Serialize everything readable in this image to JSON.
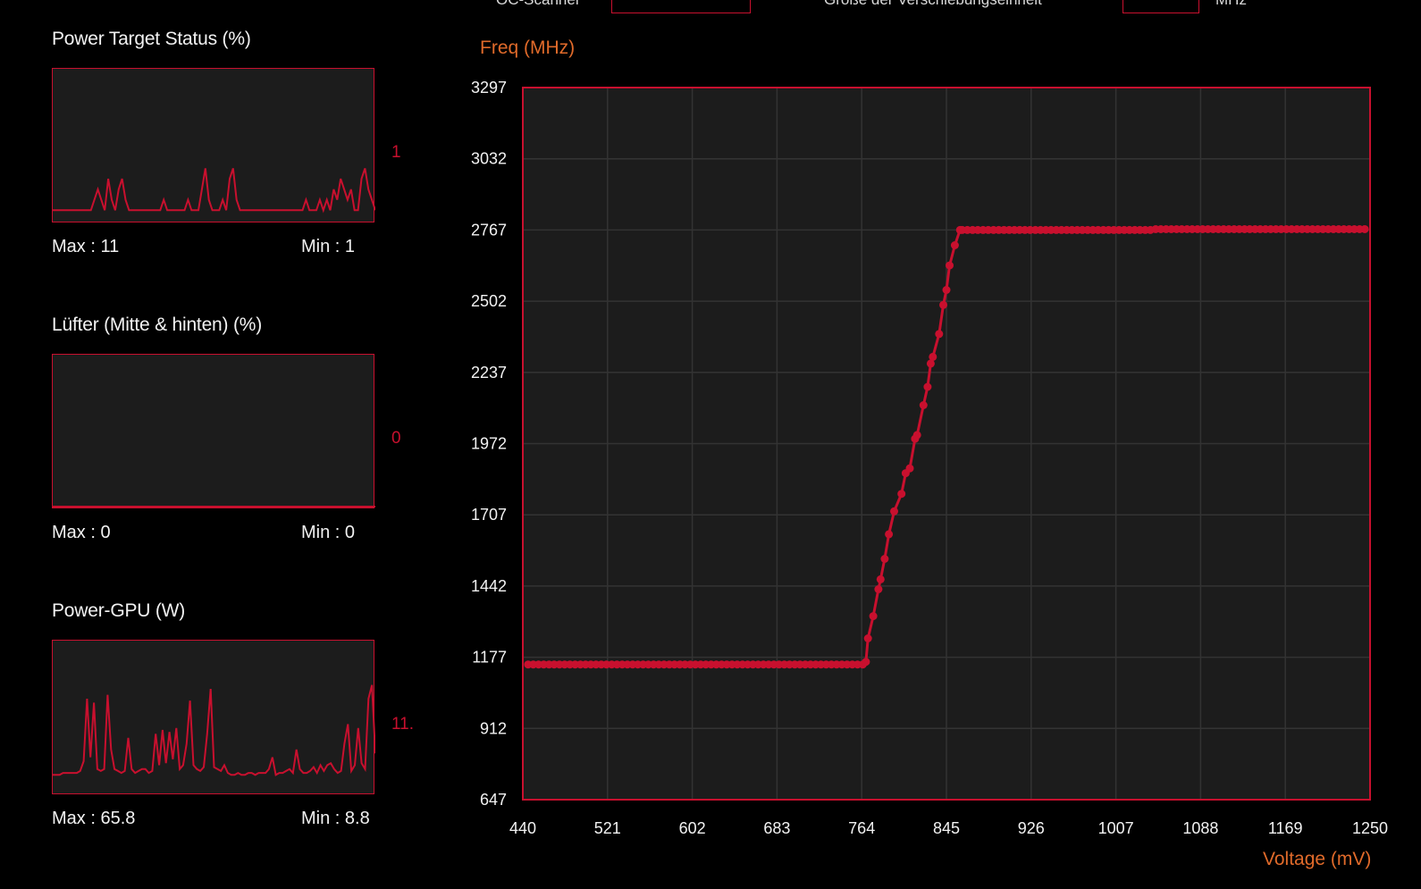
{
  "top_controls": {
    "left_label": "OC-Scanner",
    "right_label": "Größe der Verschiebungseinheit",
    "unit": "MHz"
  },
  "monitors": [
    {
      "title": "Power Target Status (%)",
      "current": "1",
      "max_label": "Max : 11",
      "min_label": "Min : 1",
      "samples": [
        1,
        1,
        1,
        1,
        1,
        1,
        1,
        1,
        1,
        1,
        1,
        1,
        2,
        3,
        2,
        1,
        4,
        2,
        1,
        3,
        4,
        2,
        1,
        1,
        1,
        1,
        1,
        1,
        1,
        1,
        1,
        1,
        2,
        1,
        1,
        1,
        1,
        1,
        1,
        2,
        1,
        1,
        1,
        3,
        5,
        2,
        1,
        1,
        1,
        2,
        1,
        4,
        5,
        2,
        1,
        1,
        1,
        1,
        1,
        1,
        1,
        1,
        1,
        1,
        1,
        1,
        1,
        1,
        1,
        1,
        1,
        1,
        1,
        2,
        1,
        1,
        1,
        2,
        1,
        2,
        1,
        3,
        2,
        4,
        3,
        2,
        3,
        1,
        1,
        4,
        5,
        3,
        2,
        1
      ]
    },
    {
      "title": "Lüfter (Mitte & hinten) (%)",
      "current": "0",
      "max_label": "Max : 0",
      "min_label": "Min : 0",
      "samples": [
        0,
        0,
        0,
        0,
        0,
        0,
        0,
        0,
        0,
        0,
        0,
        0,
        0,
        0,
        0,
        0,
        0,
        0,
        0,
        0,
        0,
        0,
        0,
        0,
        0,
        0,
        0,
        0,
        0,
        0,
        0,
        0,
        0,
        0,
        0,
        0,
        0,
        0,
        0,
        0,
        0,
        0,
        0,
        0,
        0,
        0,
        0,
        0,
        0,
        0,
        0,
        0,
        0,
        0,
        0,
        0,
        0,
        0,
        0,
        0,
        0,
        0,
        0,
        0,
        0,
        0,
        0,
        0,
        0,
        0,
        0,
        0,
        0,
        0,
        0,
        0,
        0,
        0,
        0,
        0,
        0,
        0,
        0,
        0,
        0,
        0,
        0,
        0,
        0,
        0,
        0,
        0,
        0,
        0
      ]
    },
    {
      "title": "Power-GPU (W)",
      "current": "11.",
      "max_label": "Max : 65.8",
      "min_label": "Min : 8.8",
      "samples": [
        9,
        9,
        9,
        10,
        10,
        10,
        10,
        10,
        11,
        16,
        48,
        18,
        46,
        12,
        11,
        12,
        50,
        22,
        12,
        11,
        10,
        11,
        28,
        12,
        10,
        11,
        12,
        12,
        10,
        11,
        30,
        14,
        32,
        15,
        31,
        17,
        33,
        12,
        14,
        25,
        47,
        14,
        12,
        11,
        13,
        30,
        53,
        13,
        12,
        11,
        14,
        10,
        9,
        9,
        10,
        9,
        9,
        10,
        10,
        9,
        10,
        10,
        10,
        12,
        18,
        9,
        10,
        10,
        11,
        12,
        10,
        22,
        12,
        10,
        10,
        11,
        13,
        10,
        14,
        11,
        14,
        15,
        12,
        10,
        11,
        25,
        35,
        11,
        14,
        33,
        15,
        12,
        48,
        55,
        20
      ]
    }
  ],
  "chart_data": {
    "type": "line",
    "xlabel": "Voltage (mV)",
    "ylabel": "Freq (MHz)",
    "xlim": [
      440,
      1250
    ],
    "ylim": [
      647,
      3297
    ],
    "x_ticks": [
      "440",
      "521",
      "602",
      "683",
      "764",
      "845",
      "926",
      "1007",
      "1088",
      "1169",
      "1250"
    ],
    "y_ticks": [
      "3297",
      "3032",
      "2767",
      "2502",
      "2237",
      "1972",
      "1707",
      "1442",
      "1177",
      "912",
      "647"
    ],
    "grid": true,
    "series": [
      {
        "points": [
          [
            445,
            1150
          ],
          [
            450,
            1150
          ],
          [
            455,
            1150
          ],
          [
            460,
            1150
          ],
          [
            465,
            1150
          ],
          [
            470,
            1150
          ],
          [
            475,
            1150
          ],
          [
            480,
            1150
          ],
          [
            485,
            1150
          ],
          [
            490,
            1150
          ],
          [
            495,
            1150
          ],
          [
            500,
            1150
          ],
          [
            505,
            1150
          ],
          [
            510,
            1150
          ],
          [
            515,
            1150
          ],
          [
            520,
            1150
          ],
          [
            525,
            1150
          ],
          [
            530,
            1150
          ],
          [
            535,
            1150
          ],
          [
            540,
            1150
          ],
          [
            545,
            1150
          ],
          [
            550,
            1150
          ],
          [
            555,
            1150
          ],
          [
            560,
            1150
          ],
          [
            565,
            1150
          ],
          [
            570,
            1150
          ],
          [
            575,
            1150
          ],
          [
            580,
            1150
          ],
          [
            585,
            1150
          ],
          [
            590,
            1150
          ],
          [
            595,
            1150
          ],
          [
            600,
            1150
          ],
          [
            605,
            1150
          ],
          [
            610,
            1150
          ],
          [
            615,
            1150
          ],
          [
            620,
            1150
          ],
          [
            625,
            1150
          ],
          [
            630,
            1150
          ],
          [
            635,
            1150
          ],
          [
            640,
            1150
          ],
          [
            645,
            1150
          ],
          [
            650,
            1150
          ],
          [
            655,
            1150
          ],
          [
            660,
            1150
          ],
          [
            665,
            1150
          ],
          [
            670,
            1150
          ],
          [
            675,
            1150
          ],
          [
            680,
            1150
          ],
          [
            685,
            1150
          ],
          [
            690,
            1150
          ],
          [
            695,
            1150
          ],
          [
            700,
            1150
          ],
          [
            705,
            1150
          ],
          [
            710,
            1150
          ],
          [
            715,
            1150
          ],
          [
            720,
            1150
          ],
          [
            725,
            1150
          ],
          [
            730,
            1150
          ],
          [
            735,
            1150
          ],
          [
            740,
            1150
          ],
          [
            745,
            1150
          ],
          [
            750,
            1150
          ],
          [
            755,
            1150
          ],
          [
            760,
            1150
          ],
          [
            765,
            1150
          ],
          [
            768,
            1160
          ],
          [
            770,
            1247
          ],
          [
            775,
            1330
          ],
          [
            780,
            1430
          ],
          [
            782,
            1467
          ],
          [
            786,
            1543
          ],
          [
            790,
            1635
          ],
          [
            795,
            1720
          ],
          [
            802,
            1785
          ],
          [
            806,
            1862
          ],
          [
            810,
            1880
          ],
          [
            815,
            1990
          ],
          [
            817,
            2004
          ],
          [
            823,
            2115
          ],
          [
            827,
            2183
          ],
          [
            830,
            2270
          ],
          [
            832,
            2295
          ],
          [
            838,
            2380
          ],
          [
            842,
            2488
          ],
          [
            845,
            2544
          ],
          [
            848,
            2635
          ],
          [
            853,
            2710
          ],
          [
            858,
            2767
          ],
          [
            860,
            2767
          ],
          [
            865,
            2767
          ],
          [
            870,
            2767
          ],
          [
            875,
            2767
          ],
          [
            880,
            2767
          ],
          [
            885,
            2767
          ],
          [
            890,
            2767
          ],
          [
            895,
            2767
          ],
          [
            900,
            2767
          ],
          [
            905,
            2767
          ],
          [
            910,
            2767
          ],
          [
            915,
            2767
          ],
          [
            920,
            2767
          ],
          [
            925,
            2767
          ],
          [
            930,
            2767
          ],
          [
            935,
            2767
          ],
          [
            940,
            2767
          ],
          [
            945,
            2767
          ],
          [
            950,
            2767
          ],
          [
            955,
            2767
          ],
          [
            960,
            2767
          ],
          [
            965,
            2767
          ],
          [
            970,
            2767
          ],
          [
            975,
            2767
          ],
          [
            980,
            2767
          ],
          [
            985,
            2767
          ],
          [
            990,
            2767
          ],
          [
            995,
            2767
          ],
          [
            1000,
            2767
          ],
          [
            1005,
            2767
          ],
          [
            1010,
            2767
          ],
          [
            1015,
            2767
          ],
          [
            1020,
            2767
          ],
          [
            1025,
            2767
          ],
          [
            1030,
            2767
          ],
          [
            1035,
            2767
          ],
          [
            1040,
            2767
          ],
          [
            1045,
            2770
          ],
          [
            1050,
            2770
          ],
          [
            1055,
            2770
          ],
          [
            1060,
            2770
          ],
          [
            1065,
            2770
          ],
          [
            1070,
            2770
          ],
          [
            1075,
            2770
          ],
          [
            1080,
            2770
          ],
          [
            1085,
            2770
          ],
          [
            1090,
            2770
          ],
          [
            1095,
            2770
          ],
          [
            1100,
            2770
          ],
          [
            1105,
            2770
          ],
          [
            1110,
            2770
          ],
          [
            1115,
            2770
          ],
          [
            1120,
            2770
          ],
          [
            1125,
            2770
          ],
          [
            1130,
            2770
          ],
          [
            1135,
            2770
          ],
          [
            1140,
            2770
          ],
          [
            1145,
            2770
          ],
          [
            1150,
            2770
          ],
          [
            1155,
            2770
          ],
          [
            1160,
            2770
          ],
          [
            1165,
            2770
          ],
          [
            1170,
            2770
          ],
          [
            1175,
            2770
          ],
          [
            1180,
            2770
          ],
          [
            1185,
            2770
          ],
          [
            1190,
            2770
          ],
          [
            1195,
            2770
          ],
          [
            1200,
            2770
          ],
          [
            1205,
            2770
          ],
          [
            1210,
            2770
          ],
          [
            1215,
            2770
          ],
          [
            1220,
            2770
          ],
          [
            1225,
            2770
          ],
          [
            1230,
            2770
          ],
          [
            1235,
            2770
          ],
          [
            1240,
            2770
          ],
          [
            1245,
            2770
          ]
        ]
      }
    ]
  },
  "colors": {
    "accent": "#c8102e",
    "panel_bg": "#1c1c1c",
    "grid": "#333333",
    "axis_title": "#e06a2a"
  }
}
